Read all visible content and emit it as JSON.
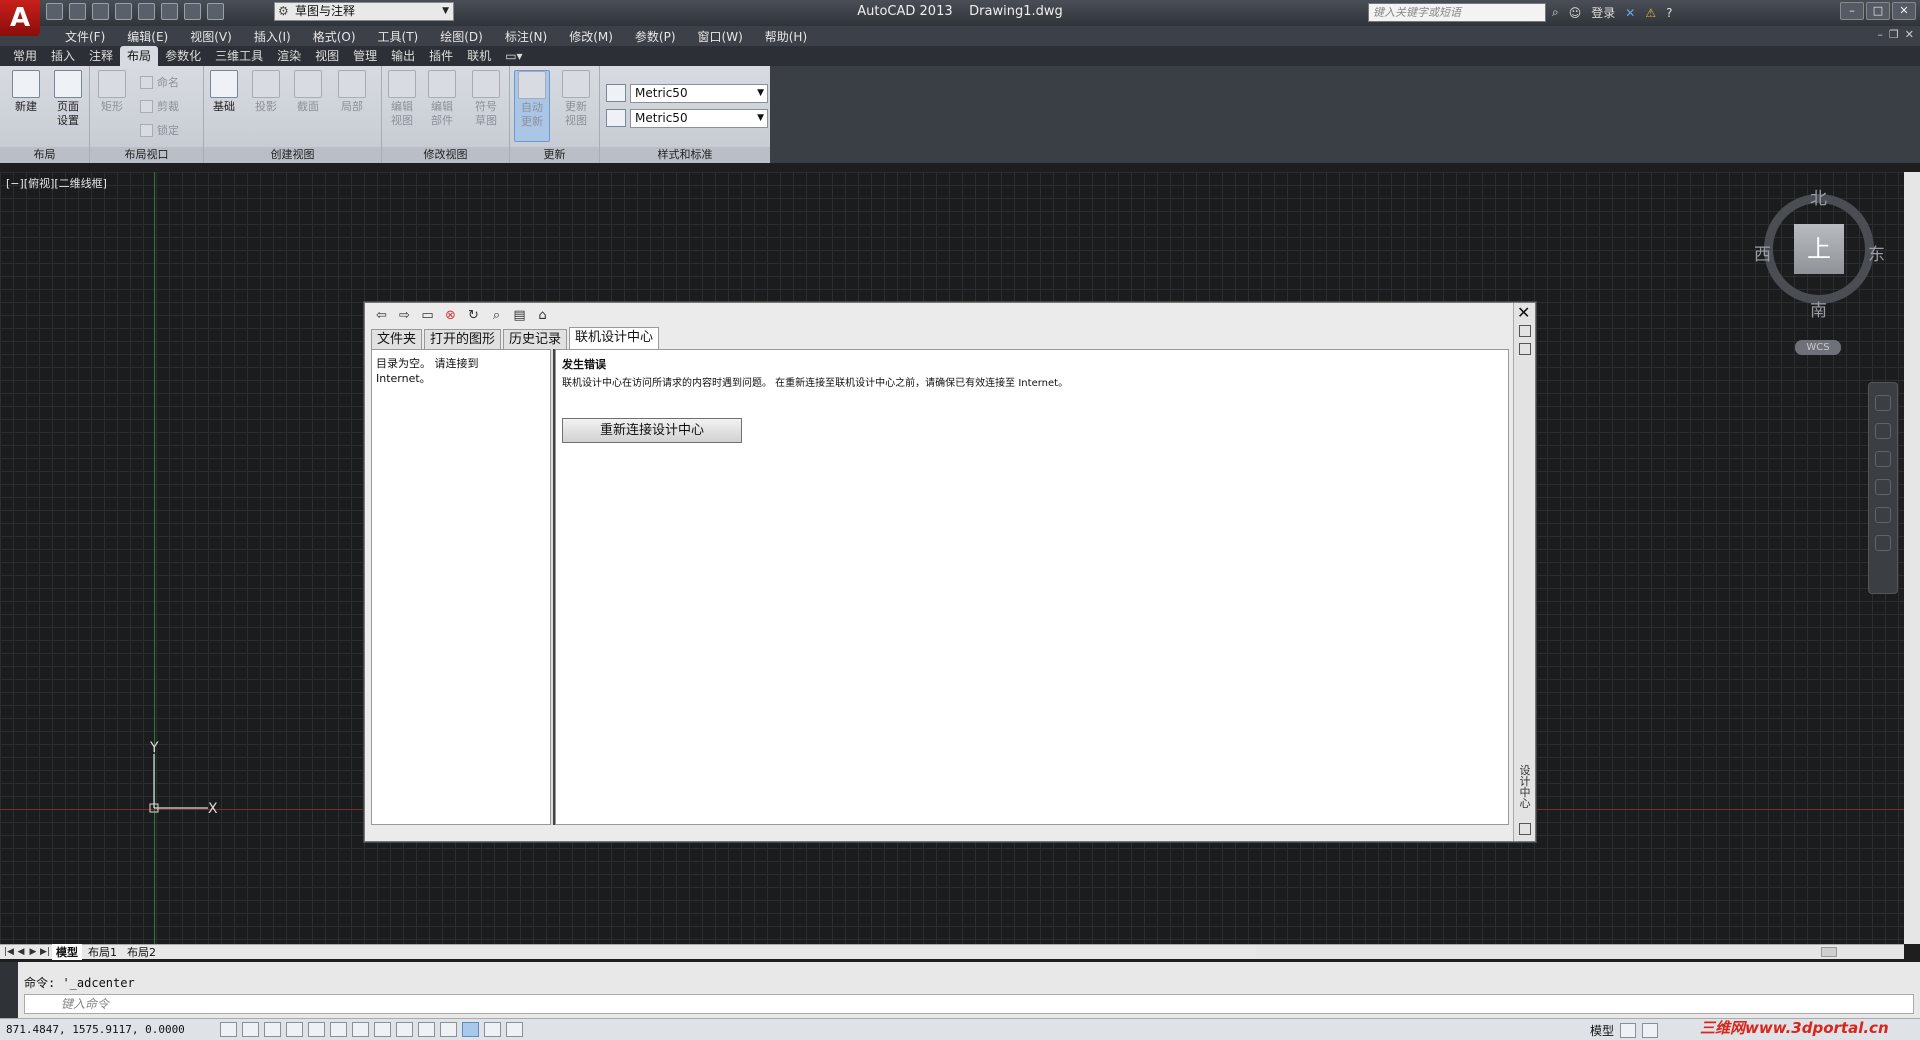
{
  "app": {
    "title": "AutoCAD 2013",
    "document": "Drawing1.dwg",
    "logo_letter": "A",
    "workspace": "草图与注释",
    "search_placeholder": "键入关键字或短语",
    "login": "登录"
  },
  "menu": [
    "文件(F)",
    "编辑(E)",
    "视图(V)",
    "插入(I)",
    "格式(O)",
    "工具(T)",
    "绘图(D)",
    "标注(N)",
    "修改(M)",
    "参数(P)",
    "窗口(W)",
    "帮助(H)"
  ],
  "ribbon_tabs": [
    "常用",
    "插入",
    "注释",
    "布局",
    "参数化",
    "三维工具",
    "渲染",
    "视图",
    "管理",
    "输出",
    "插件",
    "联机"
  ],
  "ribbon_active_tab": "布局",
  "ribbon": {
    "groups": {
      "layout": "布局",
      "layout_viewports": "布局视口",
      "create_view": "创建视图",
      "modify_view": "修改视图",
      "update": "更新",
      "styles": "样式和标准"
    },
    "buttons": {
      "new": "新建",
      "page_setup": "页面\n设置",
      "rectangle": "矩形",
      "name": "命名",
      "clip": "剪裁",
      "lock": "锁定",
      "base": "基础",
      "projected": "投影",
      "section": "截面",
      "detail": "局部",
      "edit_view": "编辑\n视图",
      "edit_component": "编辑\n部件",
      "symbol_sketch": "符号\n草图",
      "auto_update": "自动\n更新",
      "update_view": "更新\n视图"
    },
    "style_combo_1": "Metric50",
    "style_combo_2": "Metric50"
  },
  "viewport_label": "[−][俯视][二维线框]",
  "viewcube": {
    "face": "上",
    "north": "北",
    "south": "南",
    "east": "东",
    "west": "西",
    "wcs": "WCS"
  },
  "ucs": {
    "x": "X",
    "y": "Y"
  },
  "design_center": {
    "tabs": [
      "文件夹",
      "打开的图形",
      "历史记录",
      "联机设计中心"
    ],
    "active_tab": "联机设计中心",
    "left_text": "目录为空。 请连接到\nInternet。",
    "error_title": "发生错误",
    "error_message": "联机设计中心在访问所请求的内容时遇到问题。 在重新连接至联机设计中心之前，请确保已有效连接至 Internet。",
    "reconnect_button": "重新连接设计中心",
    "side_title": "设计中心"
  },
  "layout_tabs": [
    "模型",
    "布局1",
    "布局2"
  ],
  "command": {
    "history": "命令: '_adcenter",
    "placeholder": "键入命令"
  },
  "status": {
    "coords": "871.4847,  1575.9117,  0.0000",
    "model": "模型"
  },
  "watermark": "三维网www.3dportal.cn",
  "colors": {
    "title_bar": "#2f333a",
    "ribbon": "#d7dbe1",
    "canvas": "#1b1c1e",
    "grid": "#2b2d30",
    "accent_red": "#c8201c"
  }
}
